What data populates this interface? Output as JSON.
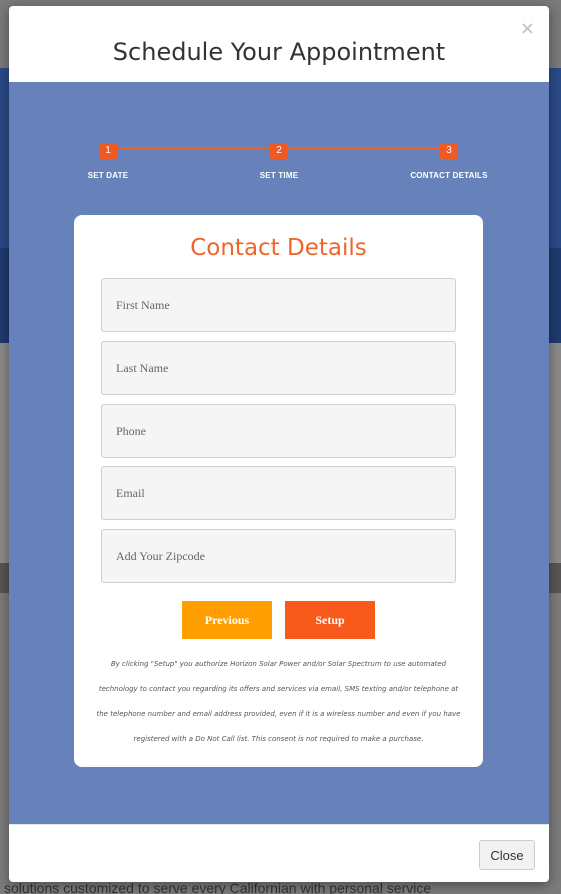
{
  "background": {
    "bottom_text": "solutions customized to serve every Californian with personal service"
  },
  "modal": {
    "title": "Schedule Your Appointment",
    "close_glyph": "×",
    "footer_close_label": "Close"
  },
  "steps": [
    {
      "number": "1",
      "label": "SET DATE"
    },
    {
      "number": "2",
      "label": "SET TIME"
    },
    {
      "number": "3",
      "label": "CONTACT DETAILS"
    }
  ],
  "form": {
    "title": "Contact Details",
    "fields": {
      "first_name": {
        "placeholder": "First Name",
        "value": ""
      },
      "last_name": {
        "placeholder": "Last Name",
        "value": ""
      },
      "phone": {
        "placeholder": "Phone",
        "value": ""
      },
      "email": {
        "placeholder": "Email",
        "value": ""
      },
      "zipcode": {
        "placeholder": "Add Your Zipcode",
        "value": ""
      }
    },
    "previous_label": "Previous",
    "setup_label": "Setup",
    "consent_text": "By clicking \"Setup\" you authorize Horizon Solar Power and/or Solar Spectrum to use automated technology to contact you regarding its offers and services via email, SMS texting and/or telephone at the telephone number and email address provided, even if it is a wireless number and even if you have registered with a Do Not Call list. This consent is not required to make a purchase."
  },
  "colors": {
    "accent_orange": "#f05a22",
    "previous_button": "#ff9e00",
    "modal_body_blue": "#6782bb",
    "title_orange": "#f0652a"
  }
}
